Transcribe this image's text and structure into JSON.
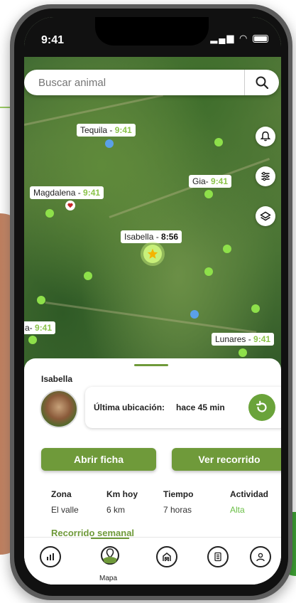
{
  "status": {
    "time": "9:41"
  },
  "search": {
    "placeholder": "Buscar animal",
    "value": "Buscar animal"
  },
  "map": {
    "labels": [
      {
        "name": "Tequila - ",
        "time": "9:41"
      },
      {
        "name": "Gia- ",
        "time": "9:41"
      },
      {
        "name": "Magdalena - ",
        "time": "9:41"
      },
      {
        "name": "Isabella - ",
        "time": "8:56"
      },
      {
        "name": "a- ",
        "time": "9:41"
      },
      {
        "name": "Lunares - ",
        "time": "9:41"
      }
    ]
  },
  "sheet": {
    "animal_name": "Isabella",
    "last_location_label": "Última ubicación:",
    "last_location_value": "hace 45 min",
    "open_record_label": "Abrir ficha",
    "view_route_label": "Ver recorrido",
    "stats": [
      {
        "header": "Zona",
        "value": "El valle"
      },
      {
        "header": "Km hoy",
        "value": "6 km"
      },
      {
        "header": "Tiempo",
        "value": "7 horas"
      },
      {
        "header": "Actividad",
        "value": "Alta"
      }
    ],
    "weekly_label": "Recorrido semanal"
  },
  "nav": {
    "active_label": "Mapa"
  },
  "colors": {
    "brand_green": "#6f9a3a",
    "dot_green": "#8ee04a",
    "dot_blue": "#5aa0e8",
    "activity_green": "#6abf46"
  },
  "icons": [
    "search-icon",
    "bell-icon",
    "filter-icon",
    "layers-icon",
    "refresh-icon",
    "chart-icon",
    "map-pin-icon",
    "barn-icon",
    "list-icon",
    "user-icon",
    "star-icon",
    "heart-icon"
  ]
}
